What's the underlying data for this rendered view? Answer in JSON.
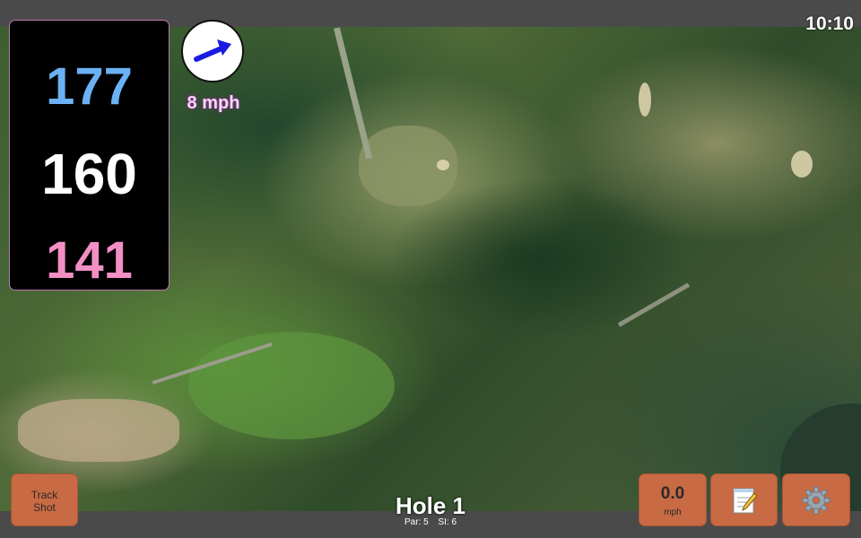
{
  "distances": {
    "back": "177",
    "middle": "160",
    "front": "141"
  },
  "wind": {
    "speed_label": "8 mph",
    "direction_icon": "arrow-right-icon"
  },
  "clock": "10:10",
  "buttons": {
    "track_shot": "Track\nShot",
    "wind_value": "0.0",
    "wind_unit": "mph",
    "notes_icon": "notepad-icon",
    "settings_icon": "gear-icon"
  },
  "hole": {
    "title": "Hole 1",
    "par": "Par: 5",
    "si": "SI: 6"
  },
  "colors": {
    "button": "#c86a43",
    "back": "#6bb2f4",
    "middle": "#ffffff",
    "front": "#f28fc4",
    "wind_arrow": "#1a1ae0"
  }
}
